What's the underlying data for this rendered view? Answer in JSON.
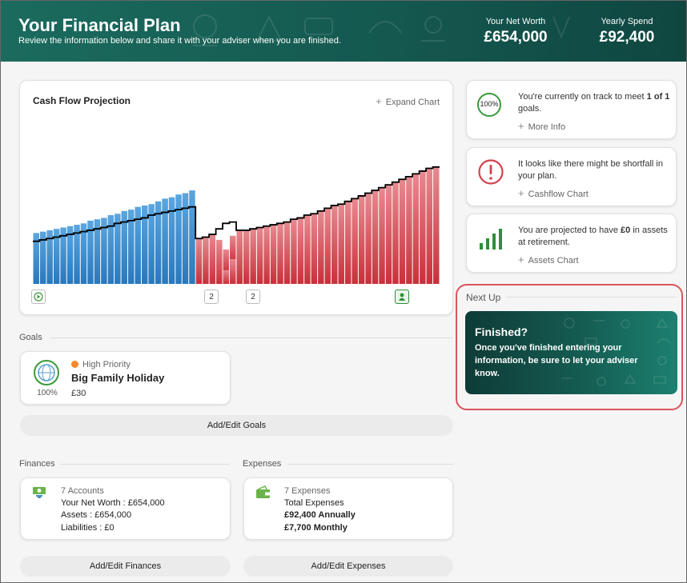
{
  "header": {
    "title": "Your Financial Plan",
    "subtitle": "Review the information below and share it with your adviser when you are finished.",
    "net_worth_label": "Your Net Worth",
    "net_worth_value": "£654,000",
    "yearly_spend_label": "Yearly Spend",
    "yearly_spend_value": "£92,400"
  },
  "cashflow": {
    "title": "Cash Flow Projection",
    "expand_label": "Expand Chart",
    "marker_1": "2",
    "marker_2": "2"
  },
  "chart_data": {
    "type": "bar",
    "title": "Cash Flow Projection",
    "xlabel": "",
    "ylabel": "",
    "ylim": [
      0,
      100
    ],
    "series": [
      {
        "values": [
          37,
          38,
          39,
          40,
          41,
          42,
          43,
          44,
          46,
          47,
          48,
          50,
          51,
          53,
          54,
          56,
          57,
          58,
          60,
          62,
          63,
          65,
          66,
          68,
          0,
          0,
          0,
          0,
          0,
          0,
          0,
          0,
          0,
          0,
          0,
          0,
          0,
          0,
          0,
          0,
          0,
          0,
          0,
          0,
          0,
          0,
          0,
          0,
          0,
          0,
          0,
          0,
          0,
          0,
          0,
          0,
          0,
          0,
          0,
          0
        ]
      },
      {
        "values": [
          0,
          0,
          0,
          0,
          0,
          0,
          0,
          0,
          0,
          0,
          0,
          0,
          0,
          0,
          0,
          0,
          0,
          0,
          0,
          0,
          0,
          0,
          0,
          0,
          33,
          34,
          36,
          32,
          10,
          18,
          39,
          39,
          40,
          41,
          42,
          43,
          44,
          45,
          47,
          48,
          50,
          51,
          53,
          55,
          57,
          58,
          60,
          62,
          64,
          66,
          68,
          70,
          72,
          74,
          76,
          78,
          80,
          82,
          84,
          85
        ]
      },
      {
        "values": [
          0,
          0,
          0,
          0,
          0,
          0,
          0,
          0,
          0,
          0,
          0,
          0,
          0,
          0,
          0,
          0,
          0,
          0,
          0,
          0,
          0,
          0,
          0,
          0,
          0,
          0,
          0,
          0,
          17,
          20,
          0,
          0,
          0,
          0,
          0,
          0,
          0,
          0,
          0,
          0,
          0,
          0,
          0,
          0,
          0,
          0,
          0,
          0,
          0,
          0,
          0,
          0,
          0,
          0,
          0,
          0,
          0,
          0,
          0,
          0
        ]
      },
      {
        "values": [
          0,
          0,
          0,
          0,
          0,
          0,
          0,
          0,
          0,
          0,
          0,
          0,
          0,
          0,
          0,
          0,
          0,
          0,
          0,
          0,
          0,
          0,
          0,
          0,
          0,
          0,
          0,
          0,
          8,
          15,
          0,
          0,
          0,
          0,
          0,
          0,
          0,
          0,
          0,
          0,
          0,
          0,
          0,
          0,
          0,
          0,
          0,
          0,
          0,
          0,
          0,
          0,
          0,
          0,
          0,
          0,
          0,
          0,
          0,
          0
        ]
      }
    ],
    "line": [
      31,
      32,
      33,
      34,
      35,
      36,
      37,
      38,
      39,
      40,
      41,
      42,
      44,
      45,
      46,
      47,
      48,
      50,
      51,
      52,
      53,
      54,
      55,
      56,
      33,
      34,
      36,
      40,
      44,
      45,
      39,
      39,
      40,
      41,
      42,
      43,
      44,
      45,
      47,
      48,
      50,
      51,
      53,
      55,
      57,
      58,
      60,
      62,
      64,
      66,
      68,
      70,
      72,
      74,
      76,
      78,
      80,
      82,
      84,
      85
    ],
    "colors": {
      "assets": "#3a86c8",
      "shortfall": "#d2424c",
      "line": "#000000"
    }
  },
  "goals": {
    "label": "Goals",
    "priority": "High Priority",
    "priority_color": "#f08a2a",
    "name": "Big Family Holiday",
    "amount": "£30",
    "percent": "100%",
    "button": "Add/Edit Goals"
  },
  "finances": {
    "label": "Finances",
    "count": "7 Accounts",
    "net_worth": "Your Net Worth : £654,000",
    "assets": "Assets : £654,000",
    "liabilities": "Liabilities : £0",
    "button": "Add/Edit Finances"
  },
  "expenses": {
    "label": "Expenses",
    "count": "7 Expenses",
    "total_label": "Total Expenses",
    "annual": "£92,400 Annually",
    "monthly": "£7,700 Monthly",
    "button": "Add/Edit Expenses"
  },
  "status": {
    "track_pct": "100%",
    "track_pre": "You're currently on track to meet ",
    "track_bold": "1 of 1",
    "track_post": " goals.",
    "track_link": "More Info",
    "shortfall_text": "It looks like there might be shortfall in your plan.",
    "shortfall_link": "Cashflow Chart",
    "assets_pre": "You are projected to have ",
    "assets_bold": "£0",
    "assets_post": " in assets at retirement.",
    "assets_link": "Assets Chart"
  },
  "next_up": {
    "label": "Next Up",
    "title": "Finished?",
    "body": "Once you've finished entering your information, be sure to let your adviser know."
  },
  "icons": {
    "track": "progress-ring-icon",
    "shortfall": "alert-circle-icon",
    "assets": "bar-chart-icon",
    "goal": "globe-icon",
    "finances": "money-icon",
    "expenses": "wallet-icon"
  }
}
